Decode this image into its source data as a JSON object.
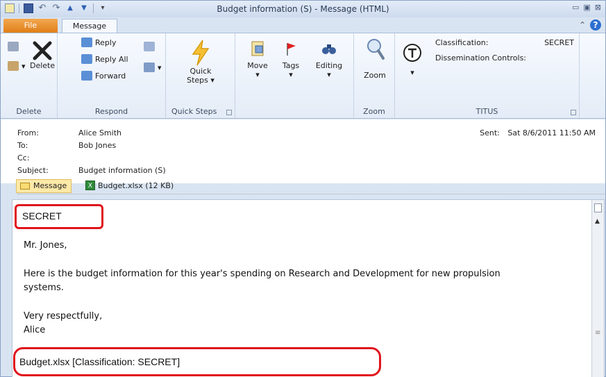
{
  "window": {
    "title": "Budget information (S) - Message (HTML)"
  },
  "ribbon": {
    "tabs": [
      "File",
      "Message"
    ],
    "groups": {
      "delete": {
        "label": "Delete",
        "buttons": [
          "Delete"
        ]
      },
      "respond": {
        "label": "Respond",
        "buttons": [
          "Reply",
          "Reply All",
          "Forward"
        ]
      },
      "quick_steps": {
        "label": "Quick Steps",
        "button_line1": "Quick",
        "button_line2": "Steps"
      },
      "move": {
        "label": "Move"
      },
      "tags": {
        "label": "Tags"
      },
      "editing": {
        "label": "Editing"
      },
      "zoom": {
        "label": "Zoom",
        "button": "Zoom"
      },
      "titus": {
        "label": "TITUS",
        "classification_label": "Classification:",
        "classification_value": "SECRET",
        "dissemination_label": "Dissemination Controls:"
      }
    }
  },
  "header": {
    "from_label": "From:",
    "from_value": "Alice Smith",
    "to_label": "To:",
    "to_value": "Bob Jones",
    "cc_label": "Cc:",
    "cc_value": "",
    "subject_label": "Subject:",
    "subject_value": "Budget information (S)",
    "sent_label": "Sent:",
    "sent_value": "Sat 8/6/2011 11:50 AM"
  },
  "attachments": {
    "message_tab": "Message",
    "file": "Budget.xlsx (12 KB)"
  },
  "body": {
    "marking": "SECRET",
    "greeting": "Mr. Jones,",
    "paragraph_line1": "Here is the budget information for this year's spending on Research and Development for new propulsion",
    "paragraph_line2": "systems.",
    "closing": "Very respectfully,",
    "signature": "Alice",
    "attachment_marking": "Budget.xlsx [Classification: SECRET]"
  },
  "colors": {
    "highlight": "#e0141c",
    "file_tab": "#e07f18",
    "ribbon_bg": "#e4ecf7"
  }
}
